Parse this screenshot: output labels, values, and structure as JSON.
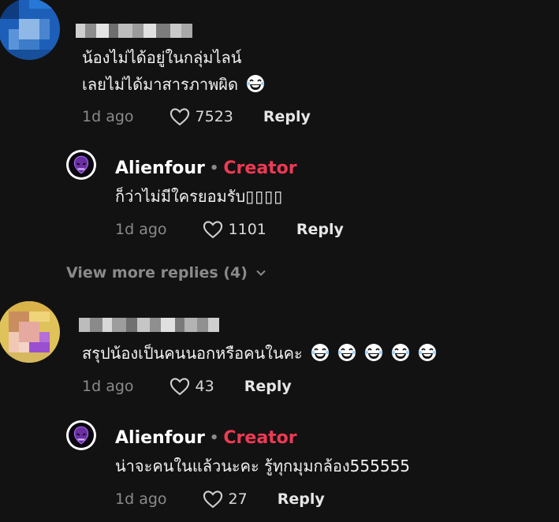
{
  "comments": [
    {
      "text_lines": [
        "น้องไม่ได้อยู่ในกลุ่มไลน์",
        "เลยไม่ได้มาสารภาพผิด"
      ],
      "time": "1d ago",
      "likes": "7523",
      "reply_label": "Reply",
      "avatar_color": "#2e6fc2",
      "emoji": "face-with-tears-of-joy",
      "reply": {
        "author": "Alienfour",
        "badge": "Creator",
        "separator": "•",
        "text": "ก็ว่าไม่มีใครยอมรับ",
        "text_suffix": "",
        "time": "1d ago",
        "likes": "1101",
        "reply_label": "Reply"
      },
      "view_more": "View more replies (4)"
    },
    {
      "text": "สรุปน้องเป็นคนนอกหรือคนในคะ",
      "emoji_count": 5,
      "time": "1d ago",
      "likes": "43",
      "reply_label": "Reply",
      "avatar_color": "#d9b34a",
      "reply": {
        "author": "Alienfour",
        "badge": "Creator",
        "separator": "•",
        "text": "น่าจะคนในแล้วนะคะ รู้ทุกมุมกล้อง555555",
        "time": "1d ago",
        "likes": "27",
        "reply_label": "Reply"
      }
    }
  ],
  "colors": {
    "background": "#121212",
    "creator": "#ee3a54",
    "muted": "#8a8a8a"
  }
}
